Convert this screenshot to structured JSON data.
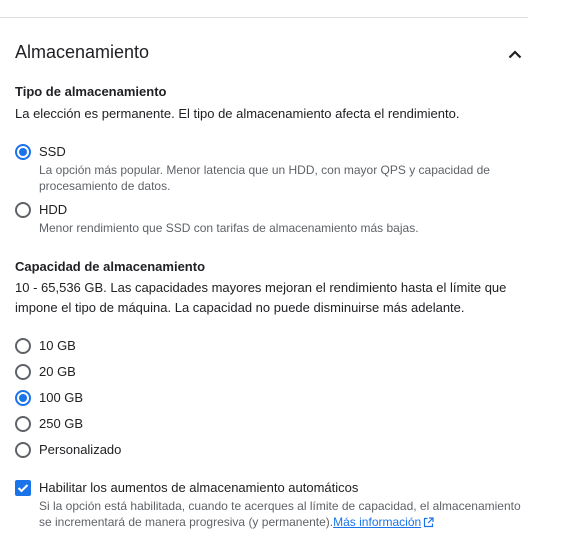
{
  "section": {
    "title": "Almacenamiento",
    "collapse_icon": "chevron-up-icon"
  },
  "storage_type": {
    "heading": "Tipo de almacenamiento",
    "description": "La elección es permanente. El tipo de almacenamiento afecta el rendimiento.",
    "options": [
      {
        "label": "SSD",
        "description": "La opción más popular. Menor latencia que un HDD, con mayor QPS y capacidad de procesamiento de datos.",
        "selected": true
      },
      {
        "label": "HDD",
        "description": "Menor rendimiento que SSD con tarifas de almacenamiento más bajas.",
        "selected": false
      }
    ]
  },
  "capacity": {
    "heading": "Capacidad de almacenamiento",
    "description": "10 - 65,536 GB. Las capacidades mayores mejoran el rendimiento hasta el límite que impone el tipo de máquina. La capacidad no puede disminuirse más adelante.",
    "options": [
      {
        "label": "10 GB",
        "selected": false
      },
      {
        "label": "20 GB",
        "selected": false
      },
      {
        "label": "100 GB",
        "selected": true
      },
      {
        "label": "250 GB",
        "selected": false
      },
      {
        "label": "Personalizado",
        "selected": false
      }
    ]
  },
  "auto_increase": {
    "label": "Habilitar los aumentos de almacenamiento automáticos",
    "checked": true,
    "description": "Si la opción está habilitada, cuando te acerques al límite de capacidad, el almacenamiento se incrementará de manera progresiva (y permanente).",
    "link_text": "Más información",
    "link_icon": "open-in-new-icon"
  },
  "colors": {
    "accent": "#1a73e8",
    "text": "#202124",
    "secondary_text": "#5f6368",
    "divider": "#dadce0"
  }
}
